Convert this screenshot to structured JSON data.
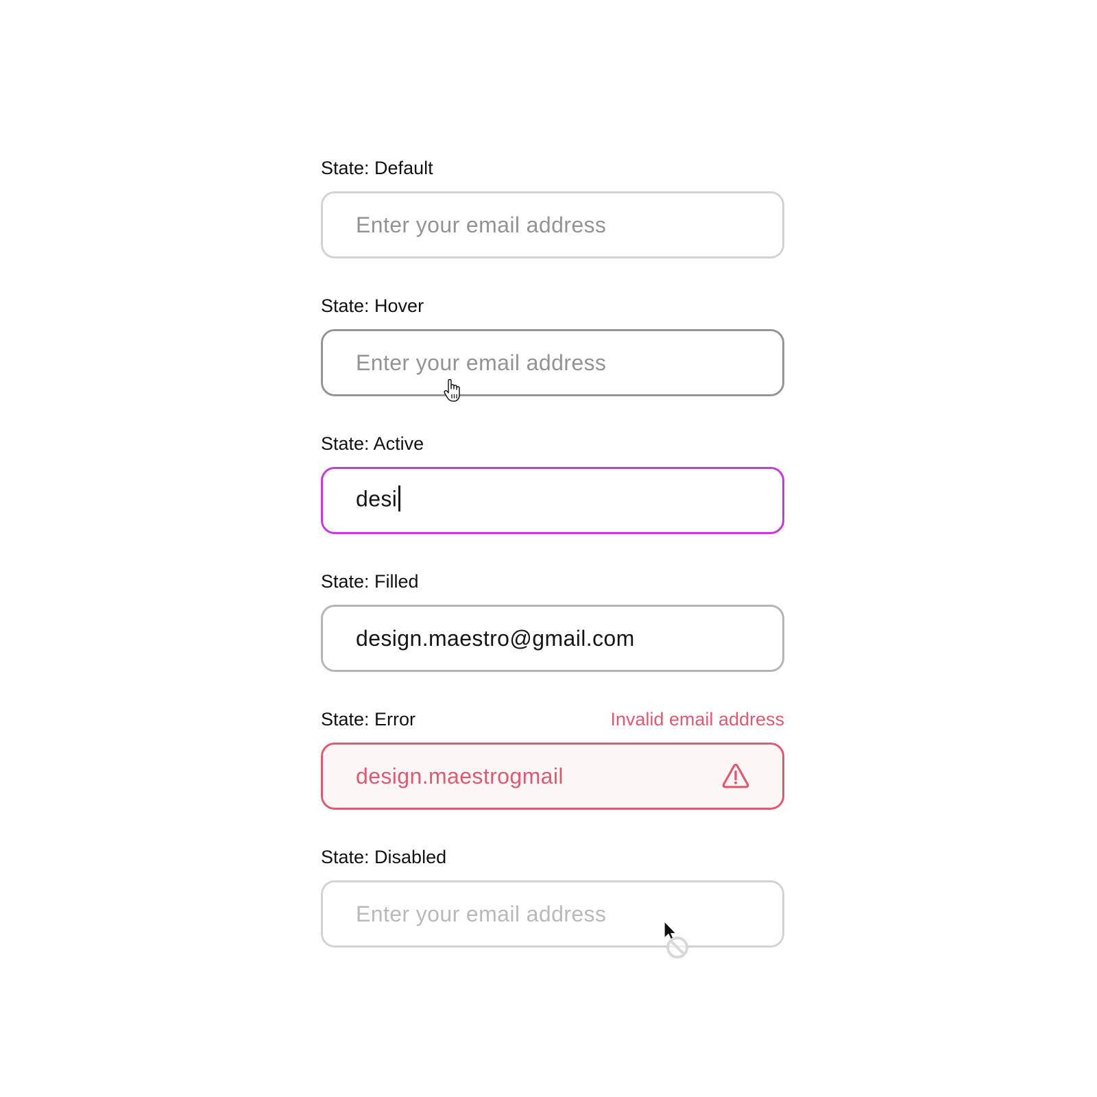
{
  "placeholder": "Enter your email address",
  "states": {
    "default": {
      "label": "State: Default"
    },
    "hover": {
      "label": "State: Hover"
    },
    "active": {
      "label": "State: Active",
      "value": "desi"
    },
    "filled": {
      "label": "State: Filled",
      "value": "design.maestro@gmail.com"
    },
    "error": {
      "label": "State: Error",
      "value": "design.maestrogmail",
      "message": "Invalid email address"
    },
    "disabled": {
      "label": "State: Disabled"
    }
  },
  "icons": {
    "hover_cursor": "hand-pointer-icon",
    "error": "warning-triangle-icon",
    "disabled_cursor": "not-allowed-cursor-icon"
  },
  "colors": {
    "default_border": "#d3d3d3",
    "hover_border": "#959595",
    "active_border": "#c63ad9",
    "filled_border": "#b5b5b5",
    "error": "#dc5b72",
    "error_background": "#fcf6f7",
    "placeholder": "#939393",
    "disabled_text": "#b9b9b9"
  }
}
